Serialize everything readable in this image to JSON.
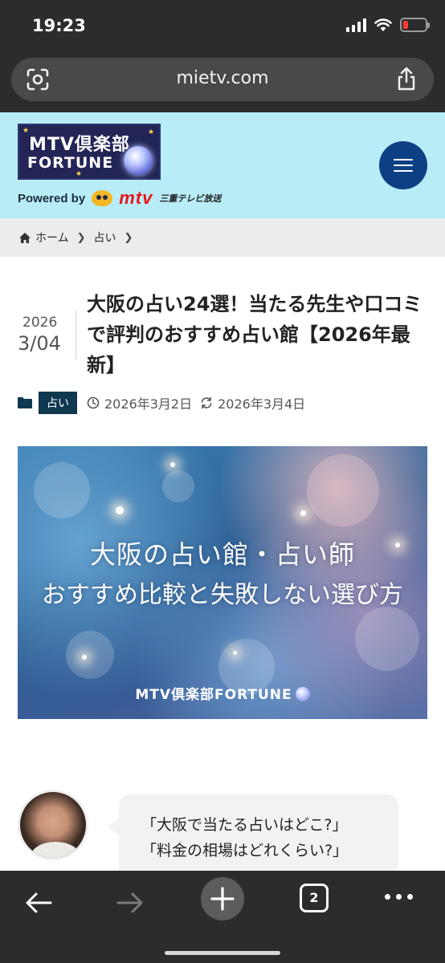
{
  "status_bar": {
    "time": "19:23"
  },
  "browser": {
    "url": "mietv.com",
    "tab_count": "2"
  },
  "site": {
    "logo_line1": "MTV倶楽部",
    "logo_line2": "FORTUNE",
    "powered_by": "Powered by",
    "brand": "mtv",
    "brand_sub": "三重テレビ放送"
  },
  "breadcrumb": {
    "home": "ホーム",
    "category": "占い"
  },
  "article": {
    "date_year": "2026",
    "date_md": "3/04",
    "title": "大阪の占い24選！当たる先生や口コミで評判のおすすめ占い館【2026年最新】",
    "category": "占い",
    "published": "2026年3月2日",
    "updated": "2026年3月4日",
    "hero_line1": "大阪の占い館・占い師",
    "hero_line2": "おすすめ比較と失敗しない選び方",
    "hero_brand": "MTV倶楽部FORTUNE",
    "speech_lines": [
      "「大阪で当たる占いはどこ?」",
      "「料金の相場はどれくらい?」"
    ]
  },
  "colors": {
    "header_bg": "#b8ecf7",
    "menu_button": "#0d3f84",
    "category_badge": "#10384f",
    "browser_chrome": "#2b2c2e"
  }
}
